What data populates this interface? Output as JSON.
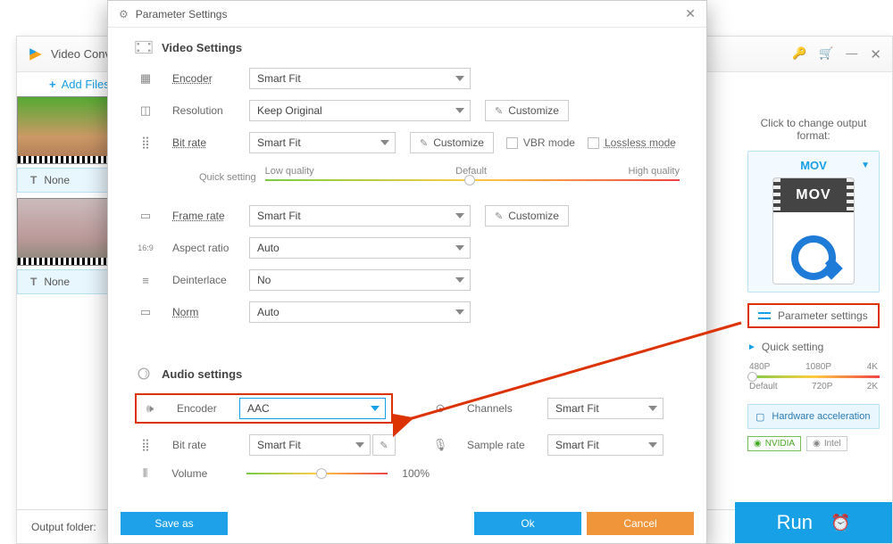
{
  "main": {
    "title": "Video Conv",
    "add_files": "Add Files",
    "none": "None",
    "output_folder_label": "Output folder:"
  },
  "right": {
    "change_label": "Click to change output format:",
    "format": "MOV",
    "badge_text": "MOV",
    "param_settings": "Parameter settings",
    "quick_setting": "Quick setting",
    "res": {
      "r1": "480P",
      "r2": "720P",
      "r3": "1080P",
      "r4": "2K",
      "r5": "4K",
      "default": "Default"
    },
    "hw_accel": "Hardware acceleration",
    "nvidia": "NVIDIA",
    "intel": "Intel",
    "run": "Run"
  },
  "dialog": {
    "title": "Parameter Settings",
    "video_section": "Video Settings",
    "audio_section": "Audio settings",
    "labels": {
      "encoder": "Encoder",
      "resolution": "Resolution",
      "bitrate": "Bit rate",
      "framerate": "Frame rate",
      "aspect": "Aspect ratio",
      "deinterlace": "Deinterlace",
      "norm": "Norm",
      "channels": "Channels",
      "samplerate": "Sample rate",
      "volume": "Volume",
      "quick_setting": "Quick setting"
    },
    "values": {
      "smart_fit": "Smart Fit",
      "keep_original": "Keep Original",
      "auto": "Auto",
      "no": "No",
      "aac": "AAC"
    },
    "customize": "Customize",
    "vbr_mode": "VBR mode",
    "lossless_mode": "Lossless mode",
    "quality": {
      "low": "Low quality",
      "default": "Default",
      "high": "High quality"
    },
    "volume_pct": "100%",
    "buttons": {
      "save_as": "Save as",
      "ok": "Ok",
      "cancel": "Cancel"
    }
  }
}
